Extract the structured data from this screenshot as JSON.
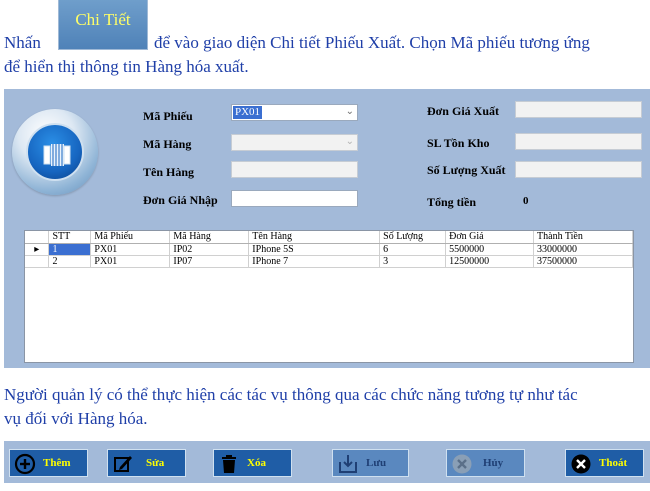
{
  "intro": {
    "before": "Nhấn",
    "button_label": "Chi Tiết",
    "after": "để vào giao diện Chi tiết Phiếu Xuất. Chọn Mã phiếu tương ứng",
    "line2": "để hiển thị thông tin Hàng hóa xuất."
  },
  "form": {
    "ma_phieu_label": "Mã Phiếu",
    "ma_phieu_value": "PX01",
    "ma_hang_label": "Mã Hàng",
    "ten_hang_label": "Tên Hàng",
    "don_gia_nhap_label": "Đơn Giá Nhập",
    "don_gia_xuat_label": "Đơn Giá Xuất",
    "sl_ton_kho_label": "SL Tồn Kho",
    "so_luong_xuat_label": "Số Lượng Xuất",
    "tong_tien_label": "Tổng tiền",
    "tong_tien_value": "0"
  },
  "grid": {
    "columns": [
      "STT",
      "Mã Phiếu",
      "Mã Hàng",
      "Tên Hàng",
      "Số Lượng",
      "Đơn Giá",
      "Thành Tiền"
    ],
    "rows": [
      {
        "indicator": "▸",
        "cells": [
          "1",
          "PX01",
          "IP02",
          "IPhone 5S",
          "6",
          "5500000",
          "33000000"
        ]
      },
      {
        "indicator": "",
        "cells": [
          "2",
          "PX01",
          "IP07",
          "IPhone 7",
          "3",
          "12500000",
          "37500000"
        ]
      }
    ]
  },
  "outro": {
    "line1": "Người quản lý có thể thực hiện các tác vụ thông qua các chức năng tương tự như tác",
    "line2": "vụ đối với Hàng hóa."
  },
  "toolbar": {
    "them": "Thêm",
    "sua": "Sửa",
    "xoa": "Xóa",
    "luu": "Lưu",
    "huy": "Hủy",
    "thoat": "Thoát"
  },
  "colors": {
    "accent_text": "#1f3fa8",
    "panel_bg": "#a3bad9",
    "button_bg": "#1f5da6",
    "button_text": "#ffff00",
    "selection": "#3b6fd1"
  }
}
